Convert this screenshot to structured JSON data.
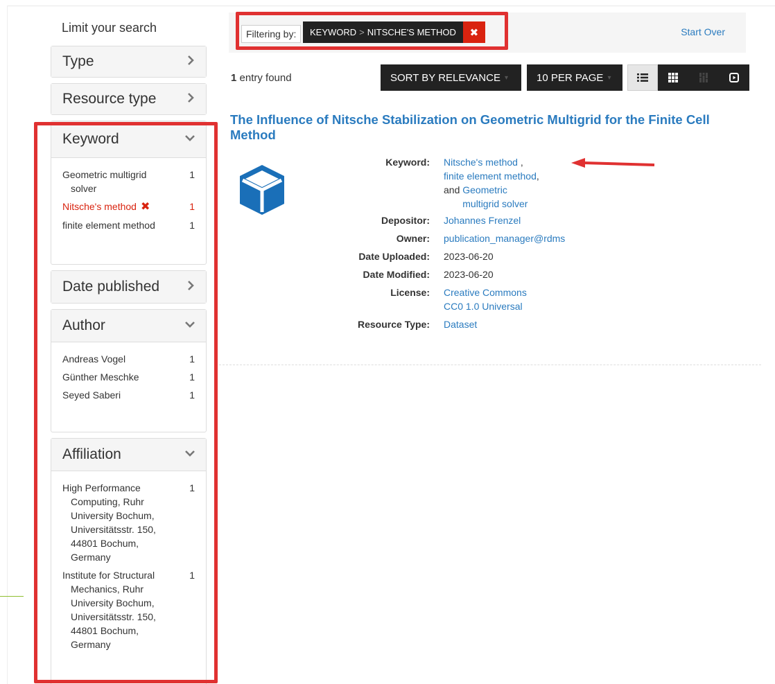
{
  "sidebar": {
    "title": "Limit your search",
    "facets": [
      {
        "title": "Type",
        "expanded": false
      },
      {
        "title": "Resource type",
        "expanded": false
      },
      {
        "title": "Keyword",
        "expanded": true,
        "items": [
          {
            "label": "Geometric multigrid solver",
            "count": "1"
          },
          {
            "label": "Nitsche's method",
            "count": "1",
            "active": true
          },
          {
            "label": "finite element method",
            "count": "1"
          }
        ]
      },
      {
        "title": "Date published",
        "expanded": false
      },
      {
        "title": "Author",
        "expanded": true,
        "items": [
          {
            "label": "Andreas Vogel",
            "count": "1"
          },
          {
            "label": "Günther Meschke",
            "count": "1"
          },
          {
            "label": "Seyed Saberi",
            "count": "1"
          }
        ]
      },
      {
        "title": "Affiliation",
        "expanded": true,
        "items": [
          {
            "label": "High Performance Computing, Ruhr University Bochum, Universitätsstr. 150, 44801 Bochum, Germany",
            "count": "1"
          },
          {
            "label": "Institute for Structural Mechanics, Ruhr University Bochum, Universitätsstr. 150, 44801 Bochum, Germany",
            "count": "1"
          }
        ]
      }
    ]
  },
  "constraints": {
    "label": "Filtering by:",
    "field": "KEYWORD",
    "separator": ">",
    "value": "NITSCHE'S METHOD",
    "remove_icon": "close-icon",
    "start_over": "Start Over"
  },
  "results_bar": {
    "count": "1",
    "count_suffix": " entry found",
    "sort_label": "SORT BY RELEVANCE",
    "per_page_label": "10 PER PAGE",
    "views": [
      "list-view-icon",
      "gallery-view-icon",
      "masonry-view-icon",
      "slideshow-view-icon"
    ]
  },
  "result": {
    "title": "The Influence of Nitsche Stabilization on Geometric Multigrid for the Finite Cell Method",
    "thumbnail_icon": "cube-icon",
    "keyword_label": "Keyword:",
    "keywords": [
      "Nitsche's method",
      "finite element method",
      "Geometric multigrid solver"
    ],
    "keyword_sep1": " ,",
    "keyword_sep2": ",",
    "keyword_and": "and ",
    "depositor_label": "Depositor:",
    "depositor": "Johannes Frenzel",
    "owner_label": "Owner:",
    "owner": "publication_manager@rdms",
    "uploaded_label": "Date Uploaded:",
    "uploaded": "2023-06-20",
    "modified_label": "Date Modified:",
    "modified": "2023-06-20",
    "license_label": "License:",
    "license": "Creative Commons CC0 1.0 Universal",
    "resource_type_label": "Resource Type:",
    "resource_type": "Dataset"
  },
  "colors": {
    "link": "#2a7bbf",
    "annotation": "#e03131",
    "active_facet": "#d9230f"
  }
}
